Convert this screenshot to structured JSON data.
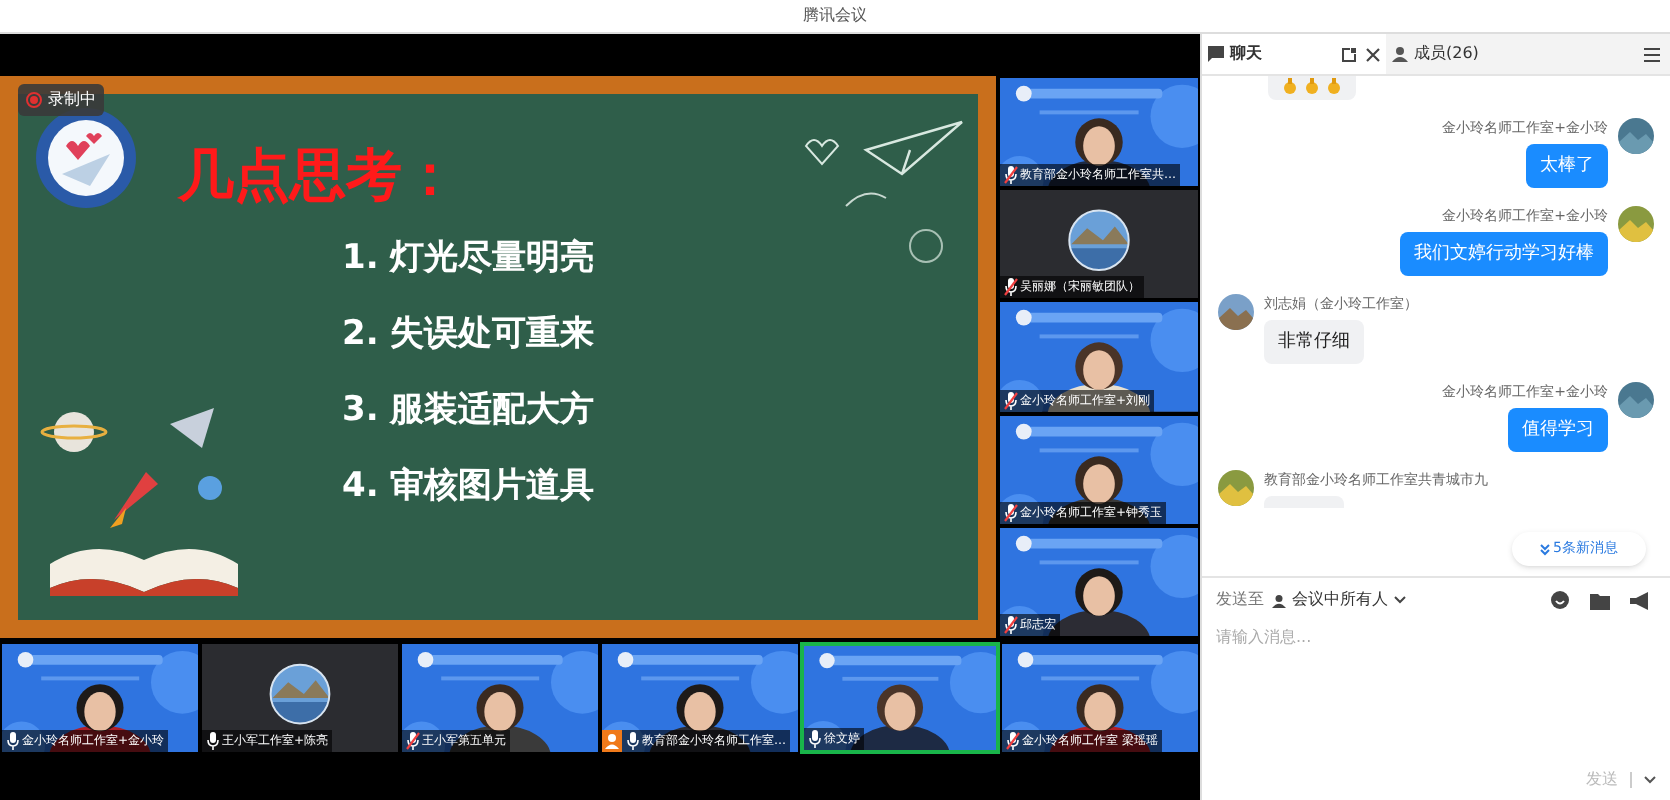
{
  "window": {
    "title": "腾讯会议"
  },
  "recording": {
    "label": "录制中"
  },
  "slide": {
    "title": "几点思考：",
    "points": [
      "1. 灯光尽量明亮",
      "2. 失误处可重来",
      "3. 服装适配大方",
      "4. 审核图片道具"
    ]
  },
  "side_tiles": [
    {
      "kind": "video",
      "name": "教育部金小玲名师工作室共…",
      "muted": true,
      "speaking": false,
      "host": false
    },
    {
      "kind": "avatar",
      "name": "吴丽娜（宋丽敏团队）",
      "muted": true,
      "speaking": false,
      "host": false
    },
    {
      "kind": "video",
      "name": "金小玲名师工作室+刘刚",
      "muted": true,
      "speaking": false,
      "host": false
    },
    {
      "kind": "video",
      "name": "金小玲名师工作室+钟秀玉",
      "muted": true,
      "speaking": false,
      "host": false
    },
    {
      "kind": "video",
      "name": "邱志宏",
      "muted": true,
      "speaking": false,
      "host": false
    }
  ],
  "bottom_tiles": [
    {
      "kind": "video",
      "name": "金小玲名师工作室+金小玲",
      "muted": false,
      "speaking": false,
      "host": false
    },
    {
      "kind": "avatar",
      "name": "王小军工作室+陈亮",
      "muted": false,
      "speaking": false,
      "host": false
    },
    {
      "kind": "video",
      "name": "王小军第五单元",
      "muted": true,
      "speaking": false,
      "host": false
    },
    {
      "kind": "video",
      "name": "教育部金小玲名师工作室…",
      "muted": false,
      "speaking": false,
      "host": true
    },
    {
      "kind": "video",
      "name": "徐文婷",
      "muted": false,
      "speaking": true,
      "host": false
    },
    {
      "kind": "video",
      "name": "金小玲名师工作室 梁瑶瑶",
      "muted": true,
      "speaking": false,
      "host": false
    }
  ],
  "panel": {
    "tabs": [
      {
        "label": "聊天",
        "selected": true
      },
      {
        "label": "成员(26)",
        "selected": false
      }
    ]
  },
  "messages": [
    {
      "kind": "icons",
      "mine": false
    },
    {
      "kind": "text",
      "mine": true,
      "sender": "金小玲名师工作室+金小玲",
      "text": "太棒了"
    },
    {
      "kind": "text",
      "mine": true,
      "sender": "金小玲名师工作室+金小玲",
      "text": "我们文婷行动学习好棒"
    },
    {
      "kind": "text",
      "mine": false,
      "sender": "刘志娟（金小玲工作室）",
      "text": "非常仔细"
    },
    {
      "kind": "text",
      "mine": true,
      "sender": "金小玲名师工作室+金小玲",
      "text": "值得学习"
    },
    {
      "kind": "cut",
      "mine": false,
      "sender": "教育部金小玲名师工作室共青城市九"
    }
  ],
  "new_messages": "5条新消息",
  "composer": {
    "send_to_label": "发送至",
    "recipient": "会议中所有人",
    "placeholder": "请输入消息...",
    "send": "发送"
  }
}
